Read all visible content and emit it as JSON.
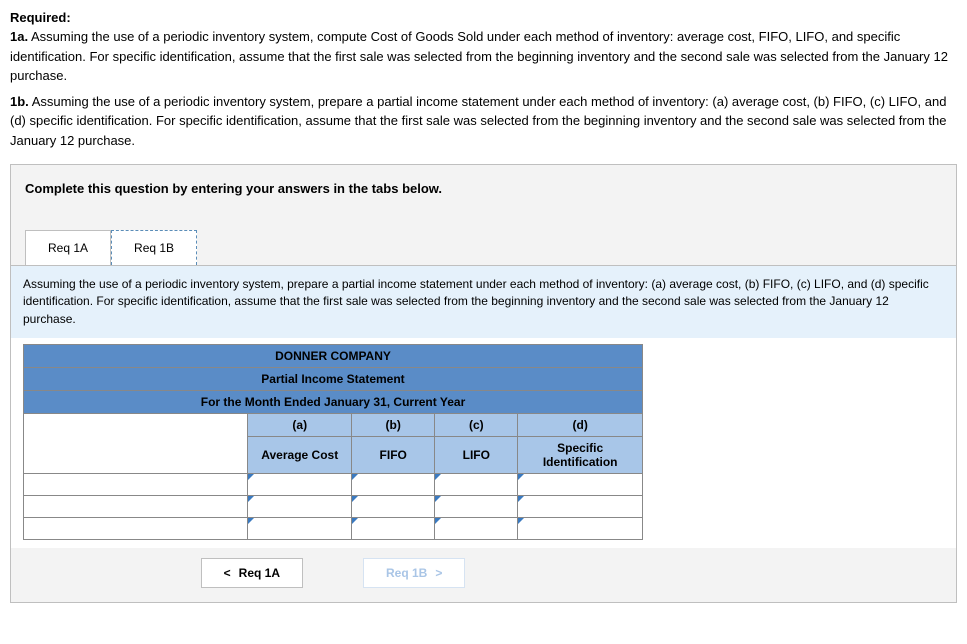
{
  "required_label": "Required:",
  "q1a_label": "1a.",
  "q1a_text": " Assuming the use of a periodic inventory system, compute Cost of Goods Sold under each method of inventory: average cost, FIFO, LIFO, and specific identification. For specific identification, assume that the first sale was selected from the beginning inventory and the second sale was selected from the January 12 purchase.",
  "q1b_label": "1b.",
  "q1b_text": " Assuming the use of a periodic inventory system, prepare a partial income statement under each method of inventory: (a) average cost, (b) FIFO, (c) LIFO, and (d) specific identification. For specific identification, assume that the first sale was selected from the beginning inventory and the second sale was selected from the January 12 purchase.",
  "instruction": "Complete this question by entering your answers in the tabs below.",
  "tabs": {
    "a": "Req 1A",
    "b": "Req 1B"
  },
  "tab_desc": "Assuming the use of a periodic inventory system, prepare a partial income statement under each method of inventory: (a) average cost, (b) FIFO, (c) LIFO, and (d) specific identification. For specific identification, assume that the first sale was selected from the beginning inventory and the second sale was selected from the January 12 purchase.",
  "table": {
    "company": "DONNER COMPANY",
    "title": "Partial Income Statement",
    "period": "For the Month Ended January 31, Current Year",
    "cols_letters": {
      "a": "(a)",
      "b": "(b)",
      "c": "(c)",
      "d": "(d)"
    },
    "cols_names": {
      "a": "Average Cost",
      "b": "FIFO",
      "c": "LIFO",
      "d": "Specific Identification"
    }
  },
  "nav": {
    "prev_chev": "<",
    "prev": "Req 1A",
    "next": "Req 1B",
    "next_chev": ">"
  }
}
